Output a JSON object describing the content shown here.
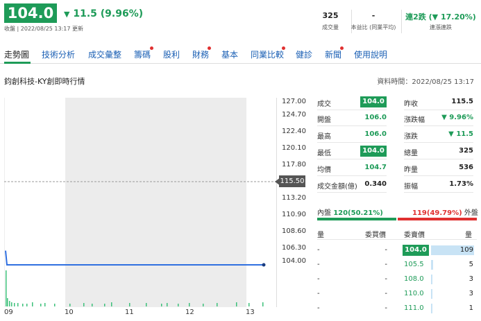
{
  "header": {
    "price": "104.0",
    "change_arrow": "▼",
    "change_text": "11.5 (9.96%)",
    "subline": "收盤 | 2022/08/25 13:17 更新",
    "stats": [
      {
        "value": "325",
        "label": "成交量"
      },
      {
        "value": "-",
        "label": "本益比 (同業平均)"
      },
      {
        "value": "連2跌 (▼ 17.20%)",
        "label": "連漲連跌"
      }
    ]
  },
  "nav": {
    "tabs": [
      {
        "label": "走勢圖",
        "active": true,
        "dot": false
      },
      {
        "label": "技術分析",
        "active": false,
        "dot": false
      },
      {
        "label": "成交彙整",
        "active": false,
        "dot": false
      },
      {
        "label": "籌碼",
        "active": false,
        "dot": true
      },
      {
        "label": "股利",
        "active": false,
        "dot": false
      },
      {
        "label": "財務",
        "active": false,
        "dot": true
      },
      {
        "label": "基本",
        "active": false,
        "dot": false
      },
      {
        "label": "同業比較",
        "active": false,
        "dot": true
      },
      {
        "label": "健診",
        "active": false,
        "dot": false
      },
      {
        "label": "新聞",
        "active": false,
        "dot": true
      },
      {
        "label": "使用說明",
        "active": false,
        "dot": false
      }
    ]
  },
  "section": {
    "title": "鈞創科技-KY創即時行情",
    "data_time": "資料時間：2022/08/25 13:17"
  },
  "chart_data": {
    "type": "line",
    "x_ticks": [
      "09",
      "10",
      "11",
      "12",
      "13"
    ],
    "y_ticks": [
      "127.00",
      "124.70",
      "122.40",
      "120.10",
      "117.80",
      "115.50",
      "113.20",
      "110.90",
      "108.60",
      "106.30",
      "104.00"
    ],
    "reference_price": "115.50",
    "ylim": [
      104.0,
      127.0
    ],
    "series": [
      {
        "values": [
          106.0,
          104.0,
          104.0
        ]
      }
    ],
    "volume_note": "volume bars along bottom"
  },
  "quote": {
    "left": [
      {
        "label": "成交",
        "value": "104.0",
        "style": "badge"
      },
      {
        "label": "開盤",
        "value": "106.0",
        "style": "green"
      },
      {
        "label": "最高",
        "value": "106.0",
        "style": "green"
      },
      {
        "label": "最低",
        "value": "104.0",
        "style": "badge"
      },
      {
        "label": "均價",
        "value": "104.7",
        "style": "green"
      },
      {
        "label": "成交金額(億)",
        "value": "0.340",
        "style": "plain"
      }
    ],
    "right": [
      {
        "label": "昨收",
        "value": "115.5",
        "style": "plain"
      },
      {
        "label": "漲跌幅",
        "value": "▼ 9.96%",
        "style": "green"
      },
      {
        "label": "漲跌",
        "value": "▼ 11.5",
        "style": "green"
      },
      {
        "label": "總量",
        "value": "325",
        "style": "plain"
      },
      {
        "label": "昨量",
        "value": "536",
        "style": "plain"
      },
      {
        "label": "振幅",
        "value": "1.73%",
        "style": "plain"
      }
    ]
  },
  "pressure": {
    "bid_label": "內盤",
    "bid_value": "120(50.21%)",
    "ask_value": "119(49.79%)",
    "ask_label": "外盤",
    "bid_ratio": 0.5021
  },
  "orderbook": {
    "headers": [
      "量",
      "委買價",
      "委賣價",
      "量"
    ],
    "rows": [
      {
        "bid_vol": "-",
        "bid_price": "-",
        "ask_price": "104.0",
        "ask_vol": "109",
        "vol_ratio": 1.0,
        "highlight": true
      },
      {
        "bid_vol": "-",
        "bid_price": "-",
        "ask_price": "105.5",
        "ask_vol": "5",
        "vol_ratio": 0.05,
        "highlight": false
      },
      {
        "bid_vol": "-",
        "bid_price": "-",
        "ask_price": "108.0",
        "ask_vol": "3",
        "vol_ratio": 0.03,
        "highlight": false
      },
      {
        "bid_vol": "-",
        "bid_price": "-",
        "ask_price": "110.0",
        "ask_vol": "3",
        "vol_ratio": 0.03,
        "highlight": false
      },
      {
        "bid_vol": "-",
        "bid_price": "-",
        "ask_price": "111.0",
        "ask_vol": "1",
        "vol_ratio": 0.01,
        "highlight": false
      }
    ]
  }
}
